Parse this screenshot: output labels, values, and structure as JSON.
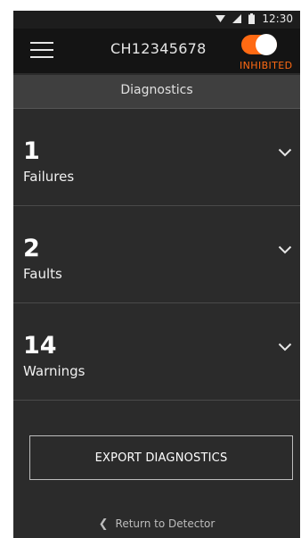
{
  "status_bar": {
    "time": "12:30",
    "icons": [
      "wifi-icon",
      "signal-icon",
      "battery-icon"
    ]
  },
  "app_bar": {
    "menu_icon": "hamburger-menu-icon",
    "device_id": "CH12345678",
    "toggle": {
      "on": true,
      "status_label": "INHIBITED"
    }
  },
  "page": {
    "title": "Diagnostics"
  },
  "diagnostics": [
    {
      "count": "1",
      "label": "Failures",
      "icon": "chevron-down-icon"
    },
    {
      "count": "2",
      "label": "Faults",
      "icon": "chevron-down-icon"
    },
    {
      "count": "14",
      "label": "Warnings",
      "icon": "chevron-down-icon"
    }
  ],
  "actions": {
    "export_label": "EXPORT DIAGNOSTICS",
    "return_label": "Return to Detector",
    "return_icon": "chevron-left-icon"
  },
  "colors": {
    "accent": "#ff6a13",
    "background": "#2b2b2b",
    "app_bar": "#141414",
    "header": "#3f3f3f"
  }
}
